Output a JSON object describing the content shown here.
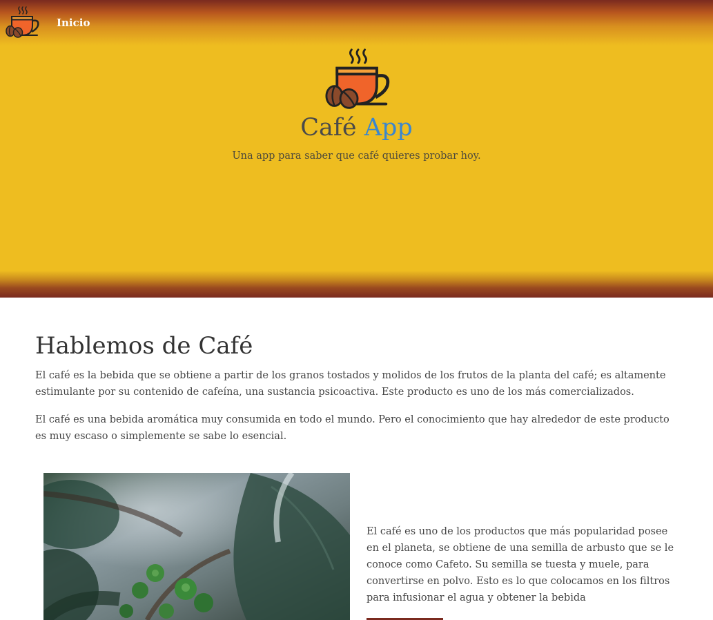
{
  "nav": {
    "logo_icon": "coffee-cup-beans-icon",
    "link_label": "Inicio"
  },
  "hero": {
    "logo_icon": "coffee-cup-beans-icon",
    "title_part1": "Café",
    "title_part2": "App",
    "subtitle": "Una app para saber que café quieres probar hoy."
  },
  "section": {
    "heading": "Hablemos de Café",
    "paragraph1": "El café es la bebida que se obtiene a partir de los granos tostados y molidos de los frutos de la planta del café; es altamente estimulante por su contenido de cafeína,  una sustancia psicoactiva. Este producto es uno de los más comercializados.",
    "paragraph2": "El café es una bebida aromática muy consumida en todo el mundo. Pero el conocimiento que hay alrededor de este producto es muy escaso o simplemente se sabe lo esencial."
  },
  "feature": {
    "image": "coffee-plant-photo",
    "text": "El café es uno de los productos que más popularidad posee en el planeta, se obtiene de una semilla de arbusto que se le conoce como Cafeto. Su semilla se tuesta y muele, para convertirse en polvo. Esto es lo que colocamos en los filtros para infusionar el agua y obtener la bebida"
  },
  "colors": {
    "hero_yellow": "#eebd20",
    "hero_edge": "#7a2a1f",
    "accent_blue": "#3a86cf",
    "cup_orange": "#f0642a"
  }
}
